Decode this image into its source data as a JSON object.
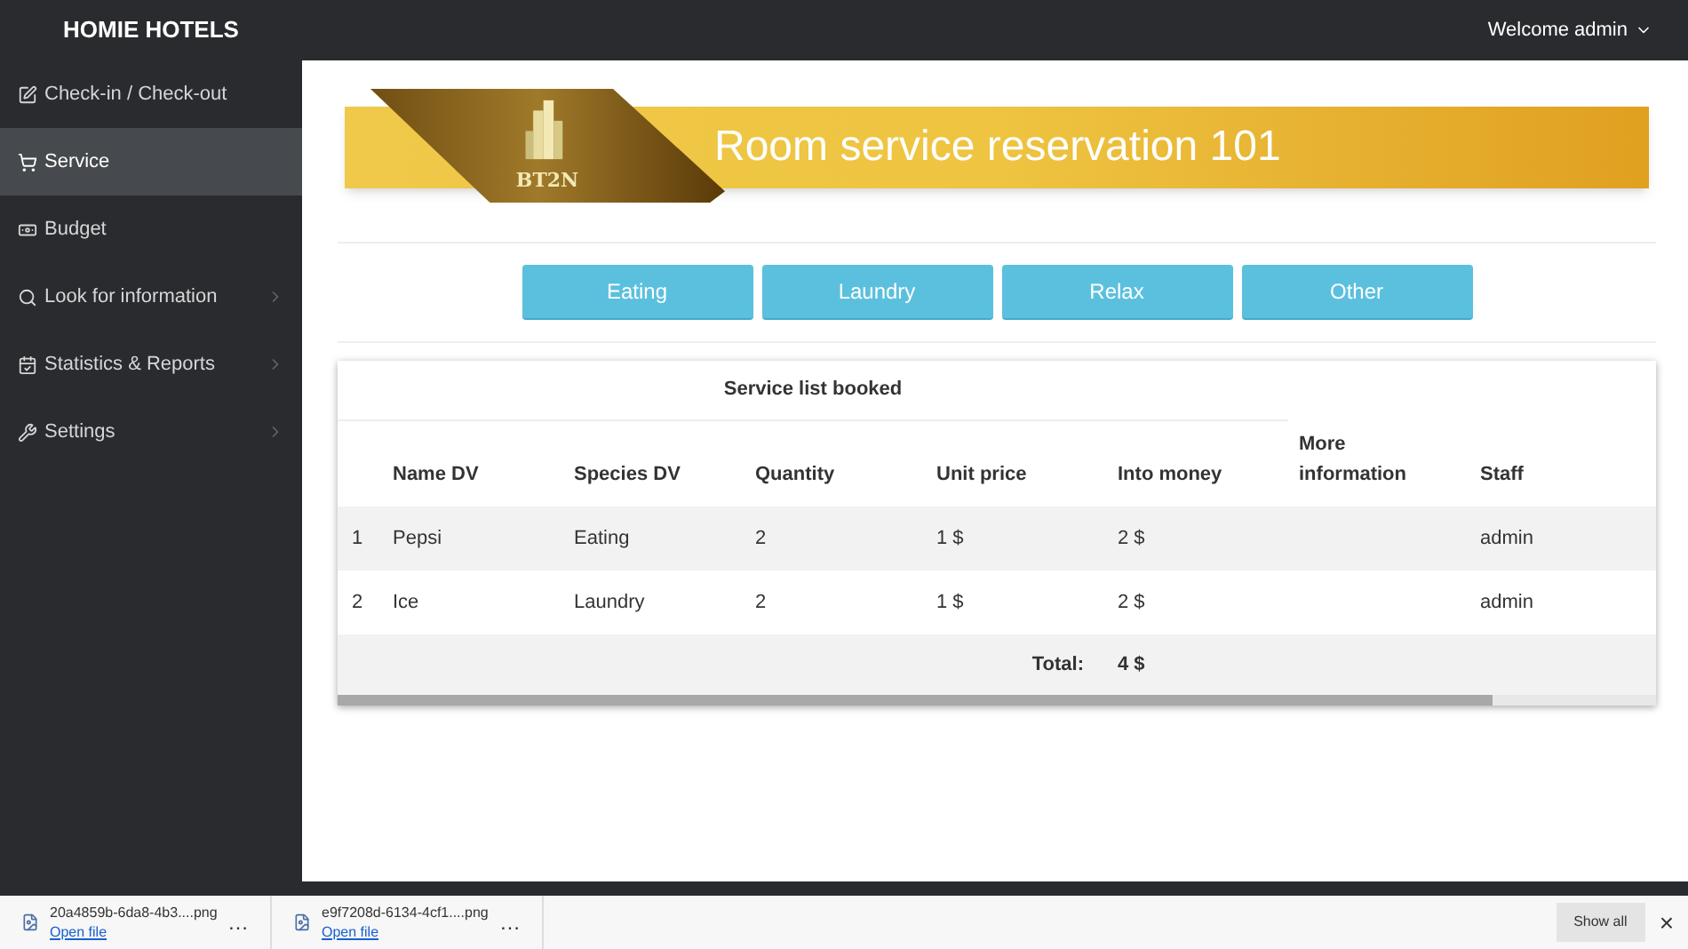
{
  "brand": "HOMIE HOTELS",
  "user_menu": {
    "label": "Welcome admin"
  },
  "sidebar": {
    "items": [
      {
        "label": "Check-in / Check-out",
        "selected": false,
        "has_submenu": false
      },
      {
        "label": "Service",
        "selected": true,
        "has_submenu": false
      },
      {
        "label": "Budget",
        "selected": false,
        "has_submenu": false
      },
      {
        "label": "Look for information",
        "selected": false,
        "has_submenu": true
      },
      {
        "label": "Statistics & Reports",
        "selected": false,
        "has_submenu": true
      },
      {
        "label": "Settings",
        "selected": false,
        "has_submenu": true
      }
    ]
  },
  "banner": {
    "logo_text": "BT2N",
    "title": "Room service reservation 101"
  },
  "category_buttons": [
    "Eating",
    "Laundry",
    "Relax",
    "Other"
  ],
  "table": {
    "caption": "Service list booked",
    "columns": [
      "",
      "Name DV",
      "Species DV",
      "Quantity",
      "Unit price",
      "Into money",
      "More information",
      "Staff"
    ],
    "rows": [
      [
        "1",
        "Pepsi",
        "Eating",
        "2",
        "1 $",
        "2 $",
        "",
        "admin"
      ],
      [
        "2",
        "Ice",
        "Laundry",
        "2",
        "1 $",
        "2 $",
        "",
        "admin"
      ]
    ],
    "total_label": "Total:",
    "total_value": "4 $"
  },
  "downloads": {
    "items": [
      {
        "file": "20a4859b-6da8-4b3....png",
        "action": "Open file",
        "more": "…"
      },
      {
        "file": "e9f7208d-6134-4cf1....png",
        "action": "Open file",
        "more": "…"
      }
    ],
    "show_all": "Show all",
    "close": "×"
  }
}
